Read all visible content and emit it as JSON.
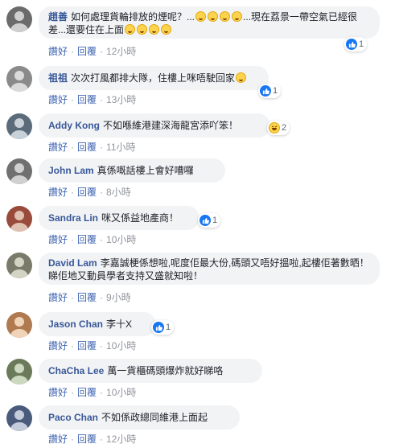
{
  "actions": {
    "like_label": "讚好",
    "reply_label": "回覆",
    "separator": "·"
  },
  "comments": [
    {
      "author": "趙善",
      "text_a": "如何處理貨輪排放的煙呢？...",
      "text_b": "...現在荔景一帶空氣已經很差...還要住在上面",
      "time": "12小時",
      "react_count": "1",
      "avatar_color": "#6b6b6b"
    },
    {
      "author": "祖祖",
      "text_a": "次次打風都排大隊，住樓上咪唔駛回家",
      "text_b": "",
      "time": "13小時",
      "react_count": "1",
      "avatar_color": "#8a8a8a"
    },
    {
      "author": "Addy Kong",
      "text_a": "不如喺維港建深海龍宮添吖笨！",
      "text_b": "",
      "time": "11小時",
      "react_count": "2",
      "avatar_color": "#5b6b7a"
    },
    {
      "author": "John Lam",
      "text_a": "真係嘅話樓上會好嘈囉",
      "text_b": "",
      "time": "8小時",
      "react_count": "",
      "avatar_color": "#707070"
    },
    {
      "author": "Sandra Lin",
      "text_a": "咪又係益地產商！",
      "text_b": "",
      "time": "10小時",
      "react_count": "1",
      "avatar_color": "#9a4a3a"
    },
    {
      "author": "David Lam",
      "text_a": "李嘉誠梗係想啦,呢度佢最大份,碼頭又唔好搵啦,起樓佢著數晒！睇佢地又動員學者支持又盛就知啦！",
      "text_b": "",
      "time": "9小時",
      "react_count": "",
      "avatar_color": "#7a7a6a"
    },
    {
      "author": "Jason Chan",
      "text_a": "李十X",
      "text_b": "",
      "time": "10小時",
      "react_count": "1",
      "avatar_color": "#b07a50"
    },
    {
      "author": "ChaCha Lee",
      "text_a": "萬一貨櫃碼頭爆炸就好睇咯",
      "text_b": "",
      "time": "10小時",
      "react_count": "",
      "avatar_color": "#6a7a5a"
    },
    {
      "author": "Paco Chan",
      "text_a": "不如係政總同維港上面起",
      "text_b": "",
      "time": "12小時",
      "react_count": "",
      "avatar_color": "#4a5a7a"
    }
  ],
  "colors": {
    "author": "#385898",
    "link": "#4267b2",
    "meta": "#90949c",
    "bubble": "#f2f3f5",
    "like": "#1877f2"
  }
}
